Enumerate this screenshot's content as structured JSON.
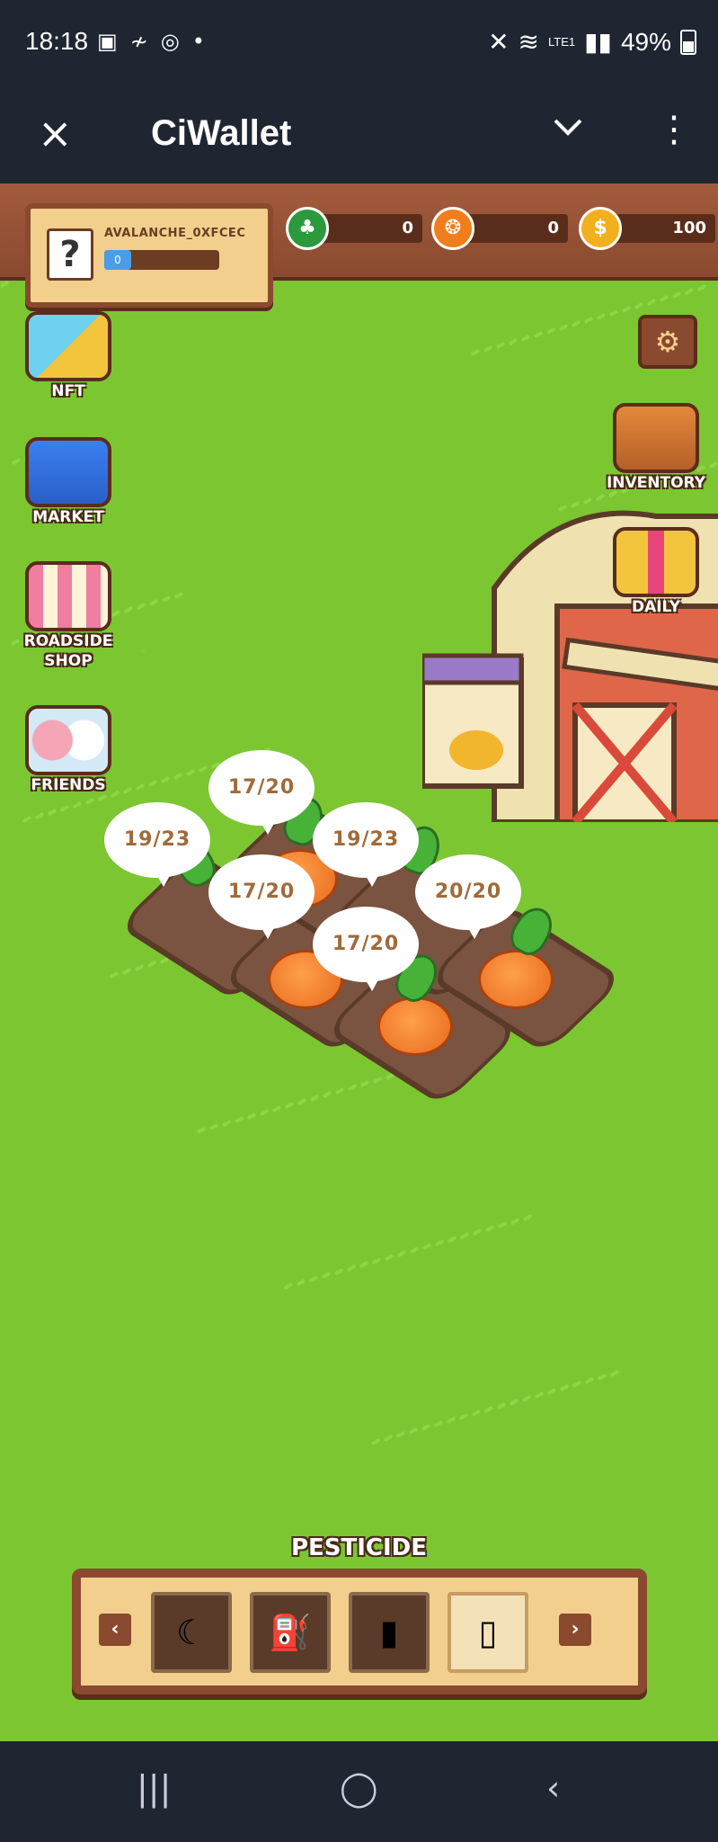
{
  "status_bar": {
    "time": "18:18",
    "battery": "49%",
    "network": "LTE1"
  },
  "app_bar": {
    "title": "CiWallet",
    "close_icon": "×",
    "chevron_icon": "⌄",
    "more_icon": "⋮"
  },
  "profile": {
    "avatar": "?",
    "name": "AVALANCHE_0XFCEC",
    "level": "0"
  },
  "currencies": [
    {
      "name": "green-token",
      "value": "0",
      "color": "#2a9a3c"
    },
    {
      "name": "orange-token",
      "value": "0",
      "color": "#f07e1c"
    },
    {
      "name": "gold-coin",
      "value": "100",
      "color": "#f2b01e",
      "symbol": "$"
    }
  ],
  "side_menu": {
    "nft": "NFT",
    "market": "MARKET",
    "roadside_shop": "ROADSIDE SHOP",
    "friends": "FRIENDS",
    "inventory": "INVENTORY",
    "daily": "DAILY"
  },
  "crops": {
    "bubble_1": "17/20",
    "bubble_2": "19/23",
    "bubble_3": "19/23",
    "bubble_4": "17/20",
    "bubble_5": "20/20",
    "bubble_6": "17/20"
  },
  "toolbar": {
    "selected_label": "PESTICIDE",
    "prev": "‹",
    "next": "›",
    "slots": [
      "sickle-icon",
      "watering-can-icon",
      "fertilizer-bottle-icon",
      "pesticide-bottle-icon"
    ]
  },
  "nav_bar": {
    "recents": "|||",
    "home": "◯",
    "back": "‹"
  }
}
